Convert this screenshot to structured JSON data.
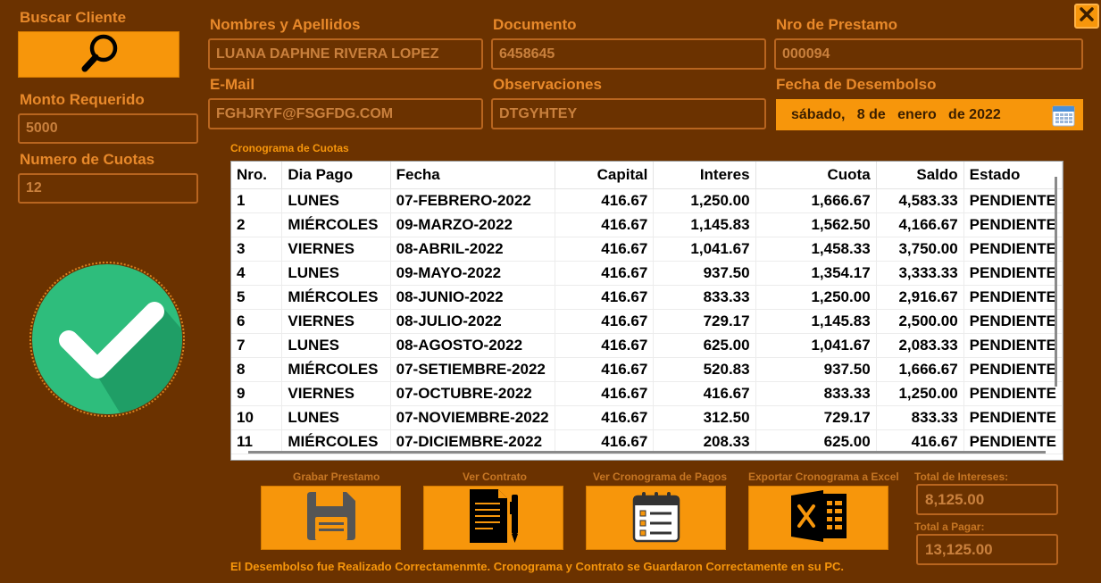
{
  "colors": {
    "background": "#6B3200",
    "accent": "#F7960B",
    "label": "#E8892A",
    "field_border": "#B8651F",
    "field_text": "#C9803D",
    "success_green": "#2EBD7C"
  },
  "search": {
    "label": "Buscar Cliente",
    "icon": "magnifier-icon"
  },
  "close": {
    "icon": "close-icon"
  },
  "monto": {
    "label": "Monto Requerido",
    "value": "5000"
  },
  "cuotas": {
    "label": "Numero de Cuotas",
    "value": "12"
  },
  "cliente": {
    "nombres_label": "Nombres y Apellidos",
    "nombres_value": "LUANA DAPHNE RIVERA LOPEZ",
    "documento_label": "Documento",
    "documento_value": "6458645",
    "prestamo_label": "Nro de Prestamo",
    "prestamo_value": "000094",
    "email_label": "E-Mail",
    "email_value": "FGHJRYF@FSGFDG.COM",
    "observaciones_label": "Observaciones",
    "observaciones_value": "DTGYHTEY",
    "fecha_label": "Fecha de Desembolso",
    "fecha_value": "sábado,   8 de   enero   de 2022"
  },
  "status_icon": "success-check-icon",
  "schedule": {
    "title": "Cronograma de Cuotas",
    "columns": [
      "Nro.",
      "Dia Pago",
      "Fecha",
      "Capital",
      "Interes",
      "Cuota",
      "Saldo",
      "Estado"
    ],
    "rows": [
      [
        "1",
        "LUNES",
        "07-FEBRERO-2022",
        "416.67",
        "1,250.00",
        "1,666.67",
        "4,583.33",
        "PENDIENTE"
      ],
      [
        "2",
        "MIÉRCOLES",
        "09-MARZO-2022",
        "416.67",
        "1,145.83",
        "1,562.50",
        "4,166.67",
        "PENDIENTE"
      ],
      [
        "3",
        "VIERNES",
        "08-ABRIL-2022",
        "416.67",
        "1,041.67",
        "1,458.33",
        "3,750.00",
        "PENDIENTE"
      ],
      [
        "4",
        "LUNES",
        "09-MAYO-2022",
        "416.67",
        "937.50",
        "1,354.17",
        "3,333.33",
        "PENDIENTE"
      ],
      [
        "5",
        "MIÉRCOLES",
        "08-JUNIO-2022",
        "416.67",
        "833.33",
        "1,250.00",
        "2,916.67",
        "PENDIENTE"
      ],
      [
        "6",
        "VIERNES",
        "08-JULIO-2022",
        "416.67",
        "729.17",
        "1,145.83",
        "2,500.00",
        "PENDIENTE"
      ],
      [
        "7",
        "LUNES",
        "08-AGOSTO-2022",
        "416.67",
        "625.00",
        "1,041.67",
        "2,083.33",
        "PENDIENTE"
      ],
      [
        "8",
        "MIÉRCOLES",
        "07-SETIEMBRE-2022",
        "416.67",
        "520.83",
        "937.50",
        "1,666.67",
        "PENDIENTE"
      ],
      [
        "9",
        "VIERNES",
        "07-OCTUBRE-2022",
        "416.67",
        "416.67",
        "833.33",
        "1,250.00",
        "PENDIENTE"
      ],
      [
        "10",
        "LUNES",
        "07-NOVIEMBRE-2022",
        "416.67",
        "312.50",
        "729.17",
        "833.33",
        "PENDIENTE"
      ],
      [
        "11",
        "MIÉRCOLES",
        "07-DICIEMBRE-2022",
        "416.67",
        "208.33",
        "625.00",
        "416.67",
        "PENDIENTE"
      ]
    ]
  },
  "actions": {
    "grabar": {
      "label": "Grabar Prestamo",
      "icon": "floppy-disk-icon"
    },
    "contrato": {
      "label": "Ver Contrato",
      "icon": "document-pen-icon"
    },
    "cronograma": {
      "label": "Ver Cronograma de Pagos",
      "icon": "calendar-checklist-icon"
    },
    "excel": {
      "label": "Exportar Cronograma a Excel",
      "icon": "excel-icon"
    }
  },
  "totals": {
    "intereses_label": "Total de Intereses:",
    "intereses_value": "8,125.00",
    "pagar_label": "Total a Pagar:",
    "pagar_value": "13,125.00"
  },
  "message": "El Desembolso fue Realizado Correctamenmte. Cronograma y Contrato se Guardaron Correctamente en su PC."
}
